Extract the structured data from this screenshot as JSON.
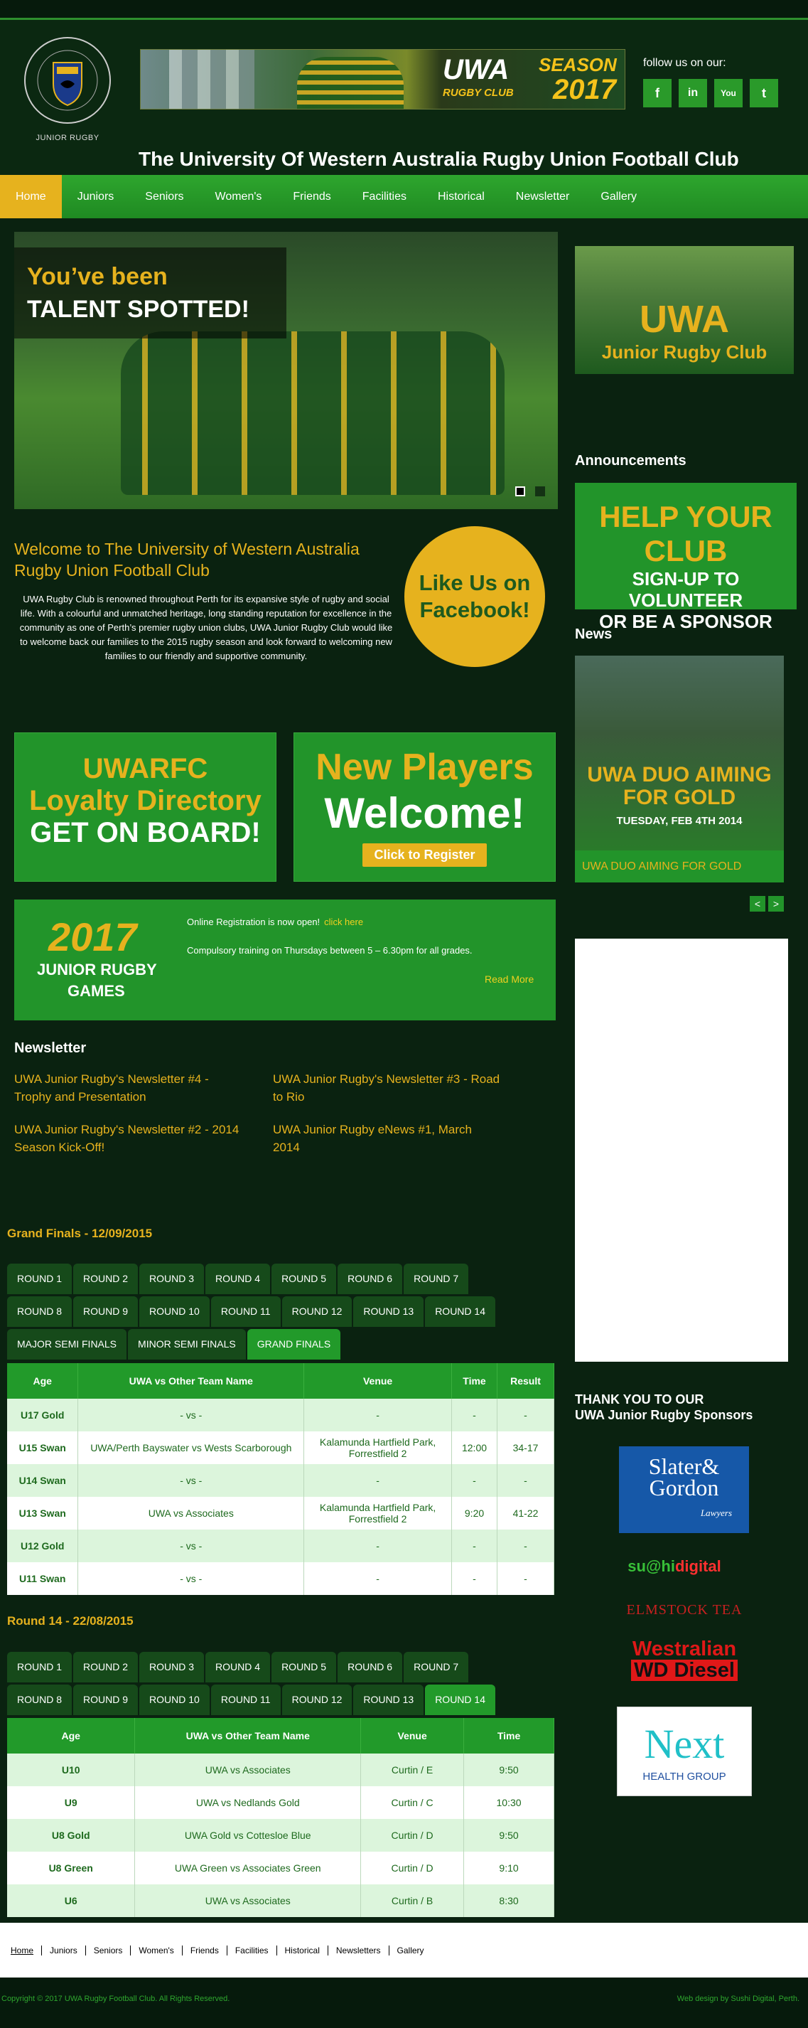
{
  "header": {
    "logo_text": "JUNIOR RUGBY",
    "logo_ring": "UNIVERSITY OF WESTERN AUSTRALIA",
    "banner": {
      "uwa": "UWA",
      "club": "RUGBY CLUB",
      "season": "SEASON",
      "year": "2017"
    },
    "follow": "follow us on our:",
    "social": [
      {
        "icon": "facebook-icon",
        "glyph": "f"
      },
      {
        "icon": "linkedin-icon",
        "glyph": "in"
      },
      {
        "icon": "youtube-icon",
        "glyph": "You"
      },
      {
        "icon": "twitter-icon",
        "glyph": "t"
      }
    ],
    "title": "The University Of Western Australia Rugby Union Football Club"
  },
  "nav": [
    "Home",
    "Juniors",
    "Seniors",
    "Women's",
    "Friends",
    "Facilities",
    "Historical",
    "Newsletter",
    "Gallery"
  ],
  "hero": {
    "caption1": "You’ve been",
    "caption2": "TALENT SPOTTED!"
  },
  "welcome": {
    "title": "Welcome to The University of Western Australia Rugby Union Football Club",
    "text": "UWA Rugby Club is renowned throughout Perth for its expansive style of rugby and social life. With a colourful and unmatched heritage, long standing reputation for excellence in the community as one of Perth’s premier rugby union clubs, UWA Junior Rugby Club would like to welcome back our families to the 2015 rugby season and look forward to welcoming new families to our friendly and supportive community.",
    "facebook": "Like Us on Facebook!"
  },
  "promo1": {
    "l1": "UWARFC",
    "l2": "Loyalty Directory",
    "l3": "GET ON BOARD!"
  },
  "promo2": {
    "l1": "New Players",
    "l2": "Welcome!",
    "button": "Click to Register"
  },
  "games": {
    "year": "2017",
    "l2": "JUNIOR RUGBY",
    "l3": "GAMES",
    "text1": "Online Registration is now open!",
    "link1": "click here",
    "text2": "Compulsory training on Thursdays between 5 – 6.30pm for all grades.",
    "more": "Read More"
  },
  "newsletter": {
    "title": "Newsletter",
    "items": [
      "UWA Junior Rugby's Newsletter #4 - Trophy and Presentation",
      "UWA Junior Rugby's Newsletter #3 - Road to Rio",
      "UWA Junior Rugby's Newsletter #2 - 2014 Season Kick-Off!",
      "UWA Junior Rugby eNews #1, March 2014"
    ]
  },
  "grand": {
    "title": "Grand Finals - 12/09/2015",
    "tabs_row1": [
      "ROUND 1",
      "ROUND 2",
      "ROUND 3",
      "ROUND 4",
      "ROUND 5",
      "ROUND 6",
      "ROUND 7"
    ],
    "tabs_row2": [
      "ROUND 8",
      "ROUND 9",
      "ROUND 10",
      "ROUND 11",
      "ROUND 12",
      "ROUND 13",
      "ROUND 14"
    ],
    "tabs_row3": [
      "MAJOR SEMI FINALS",
      "MINOR SEMI FINALS",
      "GRAND FINALS"
    ],
    "headers": [
      "Age",
      "UWA vs Other Team Name",
      "Venue",
      "Time",
      "Result"
    ],
    "rows": [
      [
        "U17 Gold",
        "- vs -",
        "-",
        "-",
        "-"
      ],
      [
        "U15 Swan",
        "UWA/Perth Bayswater vs Wests Scarborough",
        "Kalamunda Hartfield Park, Forrestfield 2",
        "12:00",
        "34-17"
      ],
      [
        "U14 Swan",
        "- vs -",
        "-",
        "-",
        "-"
      ],
      [
        "U13 Swan",
        "UWA vs Associates",
        "Kalamunda Hartfield Park, Forrestfield 2",
        "9:20",
        "41-22"
      ],
      [
        "U12 Gold",
        "- vs -",
        "-",
        "-",
        "-"
      ],
      [
        "U11 Swan",
        "- vs -",
        "-",
        "-",
        "-"
      ]
    ]
  },
  "round14": {
    "title": "Round 14 - 22/08/2015",
    "tabs_row1": [
      "ROUND 1",
      "ROUND 2",
      "ROUND 3",
      "ROUND 4",
      "ROUND 5",
      "ROUND 6",
      "ROUND 7"
    ],
    "tabs_row2": [
      "ROUND 8",
      "ROUND 9",
      "ROUND 10",
      "ROUND 11",
      "ROUND 12",
      "ROUND 13",
      "ROUND 14"
    ],
    "headers": [
      "Age",
      "UWA vs Other Team Name",
      "Venue",
      "Time"
    ],
    "rows": [
      [
        "U10",
        "UWA vs Associates",
        "Curtin / E",
        "9:50"
      ],
      [
        "U9",
        "UWA vs Nedlands Gold",
        "Curtin / C",
        "10:30"
      ],
      [
        "U8 Gold",
        "UWA Gold vs Cottesloe Blue",
        "Curtin / D",
        "9:50"
      ],
      [
        "U8 Green",
        "UWA Green vs Associates Green",
        "Curtin / D",
        "9:10"
      ],
      [
        "U6",
        "UWA vs Associates",
        "Curtin / B",
        "8:30"
      ]
    ]
  },
  "aside": {
    "junior1": "UWA",
    "junior2": "Junior Rugby Club",
    "announcements": "Announcements",
    "help1": "HELP YOUR CLUB",
    "help2": "SIGN-UP TO VOLUNTEER",
    "help3": "OR BE A SPONSOR",
    "news": "News",
    "news_img1": "UWA DUO AIMING",
    "news_img2": "FOR GOLD",
    "news_date": "TUESDAY, FEB 4TH 2014",
    "news_caption": "UWA DUO AIMING FOR GOLD",
    "prev": "<",
    "next": ">",
    "thanks1": "THANK YOU TO OUR",
    "thanks2": "UWA Junior Rugby Sponsors"
  },
  "sponsors": {
    "slater1": "Slater&",
    "slater2": "Gordon",
    "slater3": "Lawyers",
    "sushi1": "su@hi",
    "sushi2": "digital",
    "elm": "ELMSTOCK TEA",
    "west1": "Westralian",
    "west2": "WD Diesel",
    "next1": "Next",
    "next2": "HEALTH GROUP"
  },
  "footer": {
    "links": [
      "Home",
      "Juniors",
      "Seniors",
      "Women's",
      "Friends",
      "Facilities",
      "Historical",
      "Newsletters",
      "Gallery"
    ],
    "copyright": "Copyright © 2017 UWA Rugby Football Club. All Rights Reserved.",
    "credit": "Web design by Sushi Digital, Perth."
  },
  "colors": {
    "accent": "#e6b21e",
    "green": "#22942a",
    "dark": "#0a2210"
  }
}
